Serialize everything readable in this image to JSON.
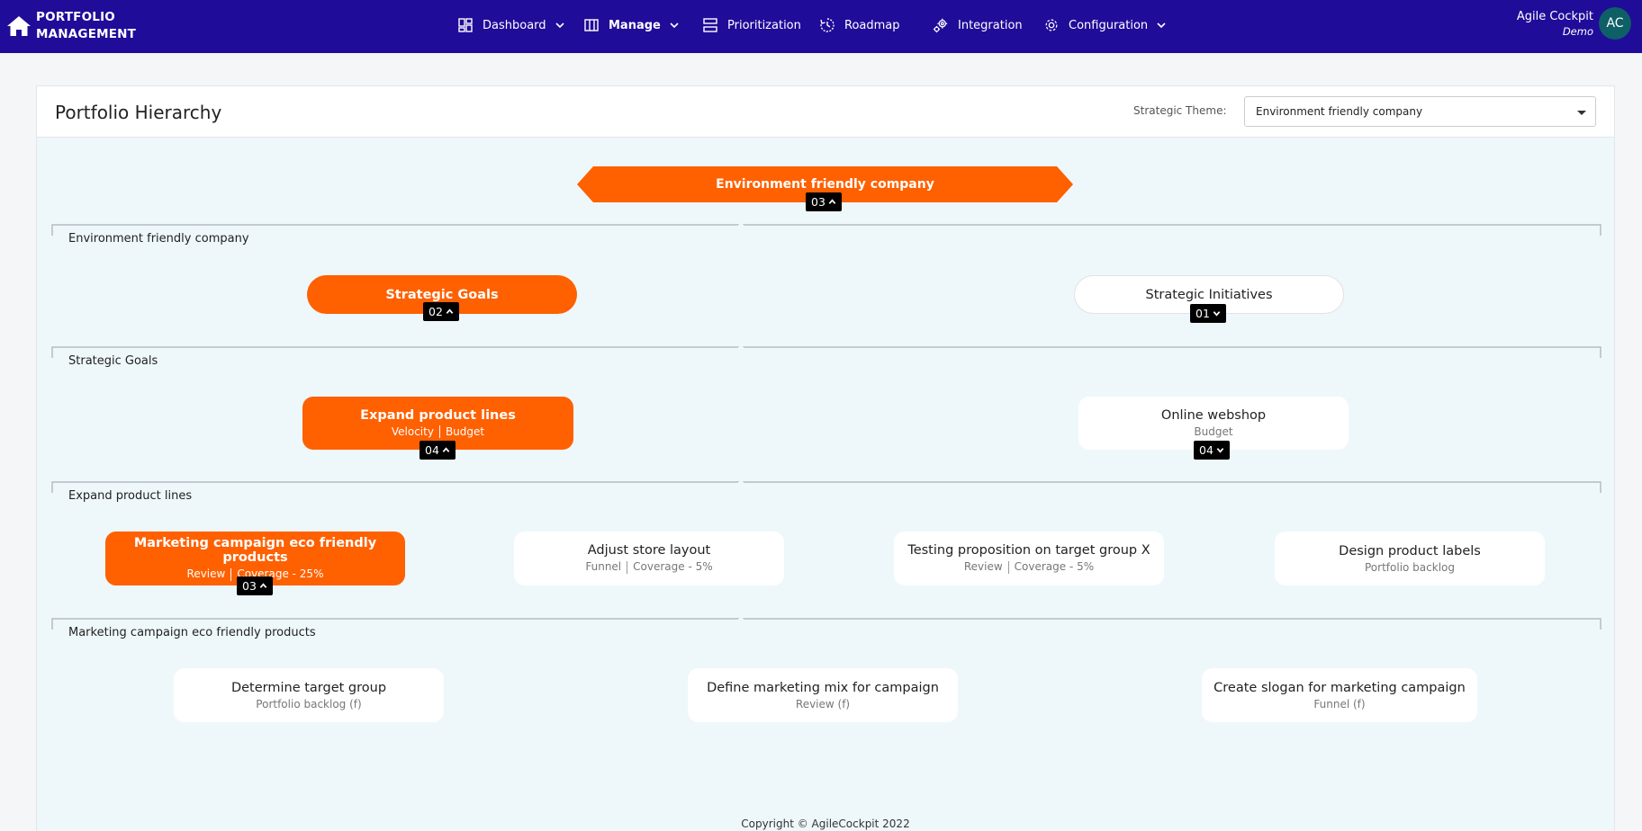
{
  "brand": {
    "line1": "PORTFOLIO",
    "line2": "MANAGEMENT"
  },
  "nav": {
    "dashboard": "Dashboard",
    "manage": "Manage",
    "prioritization": "Prioritization",
    "roadmap": "Roadmap",
    "integration": "Integration",
    "configuration": "Configuration"
  },
  "user": {
    "name": "Agile Cockpit",
    "org": "Demo",
    "initials": "AC"
  },
  "page": {
    "title": "Portfolio Hierarchy",
    "theme_label": "Strategic Theme:",
    "theme_value": "Environment friendly company"
  },
  "hierarchy": {
    "root": {
      "title": "Environment friendly company",
      "count": "03"
    },
    "level1": {
      "label": "Environment friendly company",
      "nodes": [
        {
          "title": "Strategic Goals",
          "count": "02"
        },
        {
          "title": "Strategic Initiatives",
          "count": "01"
        }
      ]
    },
    "level2": {
      "label": "Strategic Goals",
      "nodes": [
        {
          "title": "Expand product lines",
          "sub1": "Velocity",
          "sub2": "Budget",
          "count": "04"
        },
        {
          "title": "Online webshop",
          "sub1": "Budget",
          "count": "04"
        }
      ]
    },
    "level3": {
      "label": "Expand product lines",
      "nodes": [
        {
          "title": "Marketing campaign eco friendly products",
          "sub1": "Review",
          "sub2": "Coverage - 25%",
          "count": "03"
        },
        {
          "title": "Adjust store layout",
          "sub1": "Funnel",
          "sub2": "Coverage - 5%"
        },
        {
          "title": "Testing proposition on target group X",
          "sub1": "Review",
          "sub2": "Coverage - 5%"
        },
        {
          "title": "Design product labels",
          "sub1": "Portfolio backlog"
        }
      ]
    },
    "level4": {
      "label": "Marketing campaign eco friendly products",
      "nodes": [
        {
          "title": "Determine target group",
          "sub1": "Portfolio backlog (f)"
        },
        {
          "title": "Define marketing mix for campaign",
          "sub1": "Review (f)"
        },
        {
          "title": "Create slogan for marketing campaign",
          "sub1": "Funnel (f)"
        }
      ]
    }
  },
  "footer": "Copyright © AgileCockpit 2022",
  "colors": {
    "nav_bg": "#1f0c99",
    "accent": "#ff6000",
    "canvas_bg": "#eef8fb",
    "badge_bg": "#000000"
  },
  "icons": [
    "home-icon",
    "dashboard-icon",
    "manage-icon",
    "prioritization-icon",
    "roadmap-icon",
    "integration-icon",
    "configuration-icon",
    "chevron-down-icon",
    "chevron-up-icon"
  ]
}
